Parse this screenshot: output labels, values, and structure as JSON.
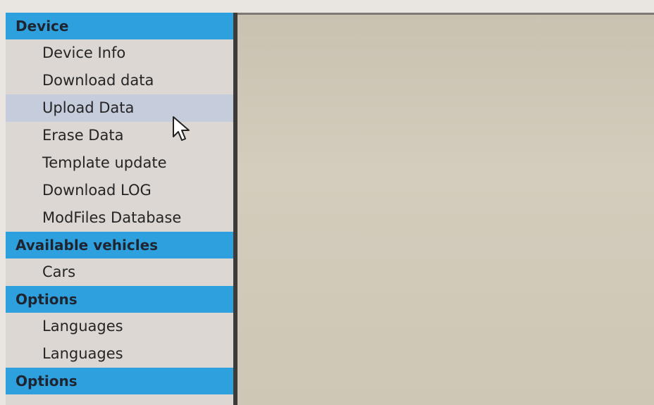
{
  "sidebar": {
    "sections": [
      {
        "header": "Device",
        "items": [
          {
            "label": "Device Info"
          },
          {
            "label": "Download data"
          },
          {
            "label": "Upload Data",
            "hovered": true
          },
          {
            "label": "Erase Data"
          },
          {
            "label": "Template update"
          },
          {
            "label": "Download LOG"
          },
          {
            "label": "ModFiles Database"
          }
        ]
      },
      {
        "header": "Available vehicles",
        "items": [
          {
            "label": "Cars"
          }
        ]
      },
      {
        "header": "Options",
        "items": [
          {
            "label": "Languages"
          },
          {
            "label": "Languages"
          }
        ]
      },
      {
        "header": "Options",
        "items": []
      }
    ]
  },
  "colors": {
    "header_bg": "#2ea0dd",
    "sidebar_bg": "#dcd7d3",
    "hover_bg": "#c5ccdb",
    "content_bg": "#cfc8b8"
  },
  "icons": {
    "cursor": "mouse-pointer-icon"
  }
}
